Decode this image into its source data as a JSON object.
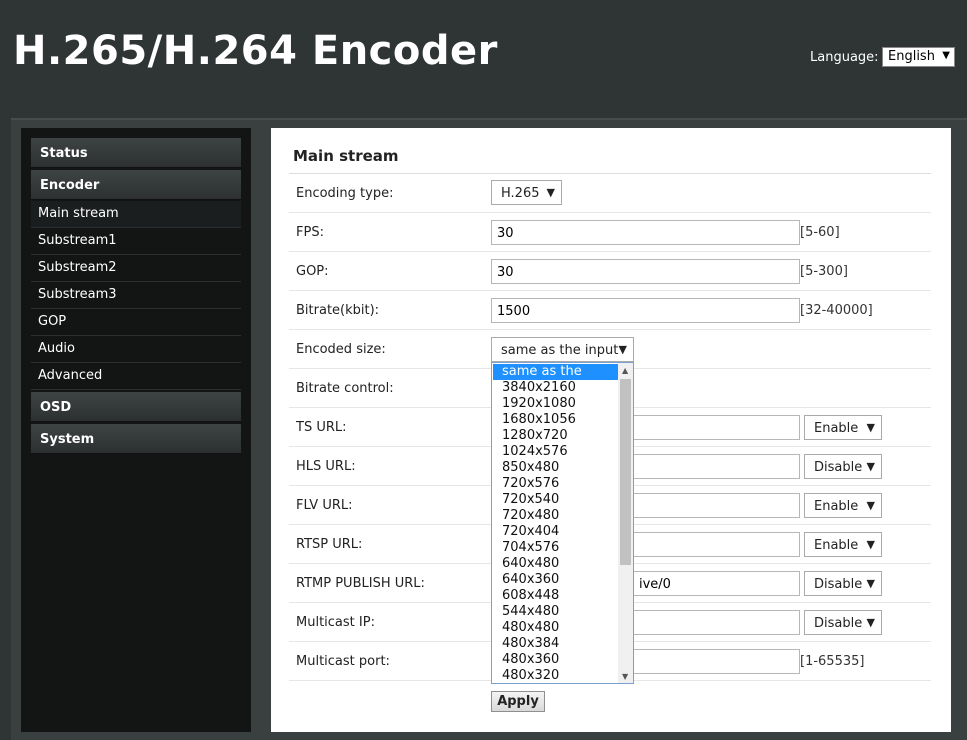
{
  "header": {
    "title": "H.265/H.264 Encoder",
    "language_label": "Language:",
    "language_value": "English"
  },
  "sidebar": {
    "sections": [
      {
        "label": "Status"
      },
      {
        "label": "Encoder"
      },
      {
        "label": "OSD"
      },
      {
        "label": "System"
      }
    ],
    "encoder_items": [
      {
        "label": "Main stream",
        "active": true
      },
      {
        "label": "Substream1"
      },
      {
        "label": "Substream2"
      },
      {
        "label": "Substream3"
      },
      {
        "label": "GOP"
      },
      {
        "label": "Audio"
      },
      {
        "label": "Advanced"
      }
    ]
  },
  "main": {
    "title": "Main stream",
    "fields": {
      "encoding_type": {
        "label": "Encoding type:",
        "value": "H.265"
      },
      "fps": {
        "label": "FPS:",
        "value": "30",
        "range": "[5-60]"
      },
      "gop": {
        "label": "GOP:",
        "value": "30",
        "range": "[5-300]"
      },
      "bitrate": {
        "label": "Bitrate(kbit):",
        "value": "1500",
        "range": "[32-40000]"
      },
      "encoded_size": {
        "label": "Encoded size:",
        "value": "same as the input"
      },
      "bitrate_control": {
        "label": "Bitrate control:"
      },
      "ts_url": {
        "label": "TS URL:",
        "value": "",
        "state": "Enable"
      },
      "hls_url": {
        "label": "HLS URL:",
        "value": "",
        "state": "Disable"
      },
      "flv_url": {
        "label": "FLV URL:",
        "value": "",
        "state": "Enable"
      },
      "rtsp_url": {
        "label": "RTSP URL:",
        "value": "",
        "state": "Enable"
      },
      "rtmp_url": {
        "label": "RTMP PUBLISH URL:",
        "value": "ive/0",
        "state": "Disable"
      },
      "multicast_ip": {
        "label": "Multicast IP:",
        "value": "",
        "state": "Disable"
      },
      "multicast_port": {
        "label": "Multicast port:",
        "value": "",
        "range": "[1-65535]"
      }
    },
    "encoded_size_options": [
      "same as the input",
      "3840x2160",
      "1920x1080",
      "1680x1056",
      "1280x720",
      "1024x576",
      "850x480",
      "720x576",
      "720x540",
      "720x480",
      "720x404",
      "704x576",
      "640x480",
      "640x360",
      "608x448",
      "544x480",
      "480x480",
      "480x384",
      "480x360",
      "480x320"
    ],
    "apply_label": "Apply"
  },
  "icons": {
    "dropdown_arrow": "caret-down-icon",
    "scroll_up": "scroll-up-icon",
    "scroll_down": "scroll-down-icon"
  }
}
